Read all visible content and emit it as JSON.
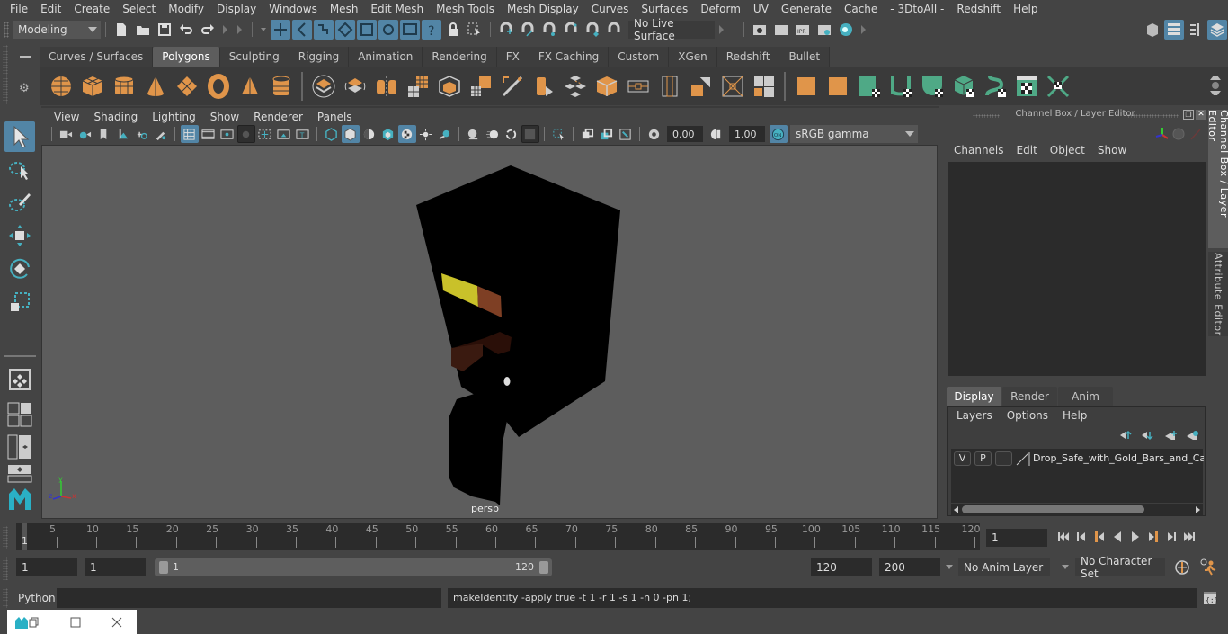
{
  "menubar": [
    "File",
    "Edit",
    "Create",
    "Select",
    "Modify",
    "Display",
    "Windows",
    "Mesh",
    "Edit Mesh",
    "Mesh Tools",
    "Mesh Display",
    "Curves",
    "Surfaces",
    "Deform",
    "UV",
    "Generate",
    "Cache",
    "- 3DtoAll -",
    "Redshift",
    "Help"
  ],
  "statusline": {
    "mode": "Modeling",
    "live_surface": "No Live Surface"
  },
  "shelf": {
    "tabs": [
      "Curves / Surfaces",
      "Polygons",
      "Sculpting",
      "Rigging",
      "Animation",
      "Rendering",
      "FX",
      "FX Caching",
      "Custom",
      "XGen",
      "Redshift",
      "Bullet"
    ],
    "active_tab": "Polygons",
    "icons": [
      "poly-sphere",
      "poly-cube",
      "poly-cylinder",
      "poly-cone",
      "poly-plane",
      "poly-torus",
      "poly-pyramid",
      "poly-pipe",
      "combine",
      "separate",
      "mirror",
      "smooth",
      "bevel",
      "extrude",
      "bridge",
      "multi-cut",
      "target-weld",
      "append-polygon",
      "fill-hole",
      "make-hole",
      "quad-draw",
      "edge-loop",
      "insert-edge-loop",
      "offset-edge-loop",
      "crease",
      "uv-planar",
      "uv-cylindrical",
      "uv-spherical",
      "uv-automatic",
      "uv-unfold",
      "uv-editor",
      "uv-layout"
    ]
  },
  "viewport": {
    "menu": [
      "View",
      "Shading",
      "Lighting",
      "Show",
      "Renderer",
      "Panels"
    ],
    "exposure": "0.00",
    "gamma": "1.00",
    "colorspace": "sRGB gamma",
    "camera_label": "persp",
    "axis": {
      "x": "x",
      "y": "y",
      "z": "z"
    }
  },
  "channelbox": {
    "title": "Channel Box / Layer Editor",
    "menu": [
      "Channels",
      "Edit",
      "Object",
      "Show"
    ]
  },
  "layereditor": {
    "tabs": [
      "Display",
      "Render",
      "Anim"
    ],
    "active_tab": "Display",
    "menu": [
      "Layers",
      "Options",
      "Help"
    ],
    "layers": [
      {
        "v": "V",
        "p": "P",
        "name": "Drop_Safe_with_Gold_Bars_and_Cash"
      }
    ]
  },
  "side_tabs": [
    "Channel Box / Layer Editor",
    "Attribute Editor"
  ],
  "timeline": {
    "ticks": [
      5,
      10,
      15,
      20,
      25,
      30,
      35,
      40,
      45,
      50,
      55,
      60,
      65,
      70,
      75,
      80,
      85,
      90,
      95,
      100,
      105,
      110,
      115,
      120
    ],
    "start_label": "1",
    "current_frame": "1",
    "range_start": "1",
    "playback_start": "1",
    "slider_start": "1",
    "slider_end": "120",
    "playback_end": "120",
    "range_end": "200",
    "anim_layer": "No Anim Layer",
    "character_set": "No Character Set"
  },
  "commandline": {
    "language": "Python",
    "input": "",
    "result": "makeIdentity -apply true -t 1 -r 1 -s 1 -n 0 -pn 1;"
  },
  "colors": {
    "accent": "#5285a6",
    "shelf_poly": "#e0954a",
    "shelf_uv": "#4fa986",
    "teal": "#46b0c0"
  }
}
